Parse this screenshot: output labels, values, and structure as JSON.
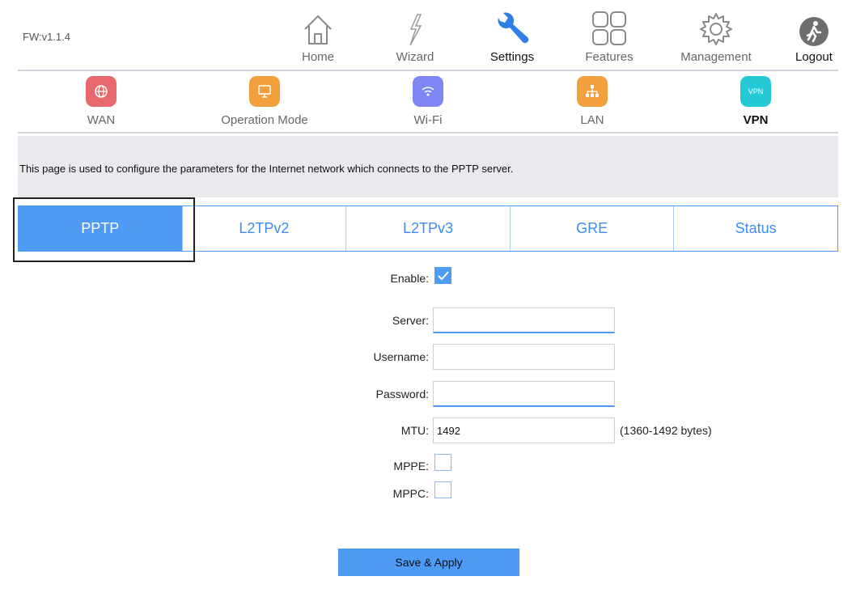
{
  "firmware": "FW:v1.1.4",
  "topnav": [
    {
      "label": "Home",
      "icon": "home-icon"
    },
    {
      "label": "Wizard",
      "icon": "wand-icon"
    },
    {
      "label": "Settings",
      "icon": "wrench-icon",
      "active": true
    },
    {
      "label": "Features",
      "icon": "grid-icon"
    },
    {
      "label": "Management",
      "icon": "gear-icon"
    },
    {
      "label": "Logout",
      "icon": "logout-icon"
    }
  ],
  "subnav": [
    {
      "label": "WAN",
      "icon": "globe-icon",
      "color": "#e8696d"
    },
    {
      "label": "Operation Mode",
      "icon": "monitor-icon",
      "color": "#f2a03d"
    },
    {
      "label": "Wi-Fi",
      "icon": "wifi-icon",
      "color": "#7d86f2"
    },
    {
      "label": "LAN",
      "icon": "lan-icon",
      "color": "#f2a03d"
    },
    {
      "label": "VPN",
      "icon": "vpn-icon",
      "color": "#25c9d6",
      "badge": "VPN",
      "active": true
    }
  ],
  "description": "This page is used to configure the parameters for the Internet network which connects to the PPTP server.",
  "tabs": [
    {
      "label": "PPTP",
      "active": true
    },
    {
      "label": "L2TPv2"
    },
    {
      "label": "L2TPv3"
    },
    {
      "label": "GRE"
    },
    {
      "label": "Status"
    }
  ],
  "form": {
    "enable_label": "Enable:",
    "enable_checked": true,
    "server_label": "Server:",
    "server_value": "",
    "username_label": "Username:",
    "username_value": "",
    "password_label": "Password:",
    "password_value": "",
    "mtu_label": "MTU:",
    "mtu_value": "1492",
    "mtu_hint": "(1360-1492 bytes)",
    "mppe_label": "MPPE:",
    "mppe_checked": false,
    "mppc_label": "MPPC:",
    "mppc_checked": false
  },
  "save_label": "Save & Apply",
  "colors": {
    "accent": "#4d9bf5",
    "settings_icon": "#2f80e6"
  }
}
